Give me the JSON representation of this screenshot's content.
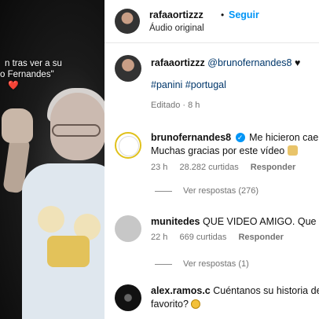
{
  "video": {
    "caption_lines": [
      "n tras ver a su",
      "o Fernandes\"",
      "❤️"
    ]
  },
  "header": {
    "username": "rafaaortizzz",
    "separator": "•",
    "follow_label": "Seguir",
    "audio_label": "Áudio original"
  },
  "post": {
    "username": "rafaaortizzz",
    "mention": "@brunofernandes8",
    "heart": "♥",
    "tags": "#panini #portugal",
    "edited_label": "Editado · 8 h"
  },
  "comments": [
    {
      "username": "brunofernandes8",
      "verified_mark": "✓",
      "text_line1": "Me hicieron caer",
      "text_line2": "Muchas gracias por este vídeo",
      "time": "23 h",
      "likes": "28.282 curtidas",
      "reply_label": "Responder",
      "view_replies": "Ver respostas (276)"
    },
    {
      "username": "munitedes",
      "text_line1": "QUE VIDEO AMIGO. Que m",
      "time": "22 h",
      "likes": "669 curtidas",
      "reply_label": "Responder",
      "view_replies": "Ver respostas (1)"
    },
    {
      "username": "alex.ramos.c",
      "text_line1": "Cuéntanos su historia del",
      "text_line2": "favorito?"
    }
  ],
  "icons": {
    "verified": "verified-badge-icon",
    "emoji_hands": "face-holding-back-tears-emoji",
    "emoji_smile": "grimacing-emoji"
  }
}
